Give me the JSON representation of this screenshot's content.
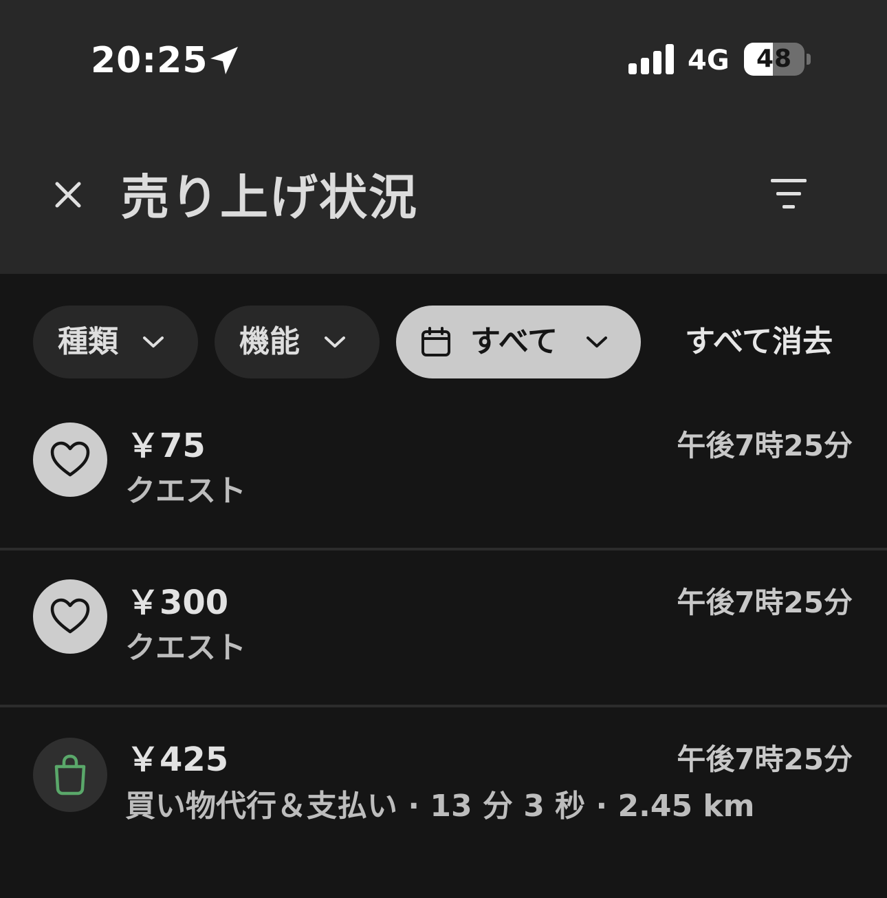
{
  "status_bar": {
    "time": "20:25",
    "network": "4G",
    "battery_percent": "48",
    "battery_level": 0.48,
    "signal_bars": 4
  },
  "header": {
    "title": "売り上げ状況"
  },
  "filters": {
    "chips": [
      {
        "label": "種類"
      },
      {
        "label": "機能"
      },
      {
        "label": "すべて",
        "selected": true
      }
    ],
    "clear_all": "すべて消去"
  },
  "transactions": [
    {
      "amount": "￥75",
      "type": "クエスト",
      "time": "午後7時25分",
      "icon": "heart-icon"
    },
    {
      "amount": "￥300",
      "type": "クエスト",
      "time": "午後7時25分",
      "icon": "heart-icon"
    },
    {
      "amount": "￥425",
      "type": "買い物代行＆支払い · 13 分 3 秒 · 2.45 km",
      "time": "午後7時25分",
      "icon": "shopping-bag-icon"
    }
  ],
  "colors": {
    "background": "#151515",
    "header_background": "#282828",
    "chip_background": "#282828",
    "chip_selected_background": "#cacaca",
    "shopping_icon_color": "#5aa86a"
  }
}
